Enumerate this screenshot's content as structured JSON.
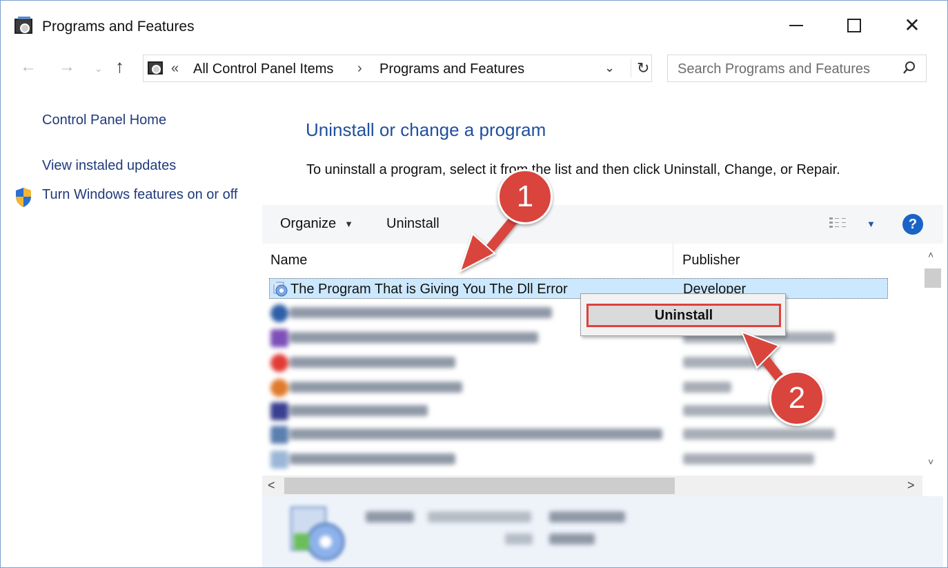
{
  "window": {
    "title": "Programs and Features",
    "minimize_glyph": "–",
    "maximize_glyph": "☐",
    "close_glyph": "✕"
  },
  "nav": {
    "back_glyph": "←",
    "forward_glyph": "→",
    "recent_glyph": "⌄",
    "up_glyph": "↑",
    "overflow": "«",
    "breadcrumbs": [
      "All Control Panel Items",
      "Programs and Features"
    ],
    "separator": "›",
    "dropdown_glyph": "⌄",
    "refresh_glyph": "↻",
    "search_placeholder": "Search Programs and Features",
    "search_glyph": "⚲"
  },
  "left_pane": {
    "links": [
      "Control Panel Home",
      "View instaled updates",
      "Turn Windows features on or off"
    ]
  },
  "main": {
    "title": "Uninstall or change a program",
    "description": "To uninstall a program, select it from the list and then click Uninstall, Change, or Repair."
  },
  "toolbar": {
    "organize_label": "Organize",
    "uninstall_label": "Uninstall",
    "caret": "▼",
    "help_label": "?"
  },
  "list": {
    "columns": [
      "Name",
      "Publisher"
    ],
    "selected_row": {
      "name": "The Program That is Giving You The Dll Error",
      "publisher": "Developer"
    }
  },
  "scrollbars": {
    "up": "˄",
    "down": "˅",
    "left": "<",
    "right": ">"
  },
  "context_menu": {
    "item_label": "Uninstall"
  },
  "annotations": {
    "step1": "1",
    "step2": "2",
    "color": "#d9443d"
  },
  "colors": {
    "link": "#1f3a7a",
    "heading": "#1f4f9e",
    "selection": "#cce8ff",
    "help": "#1a63c7"
  },
  "icons": [
    "control-panel-icon",
    "shield-icon",
    "search-icon",
    "help-icon",
    "view-options-icon"
  ]
}
